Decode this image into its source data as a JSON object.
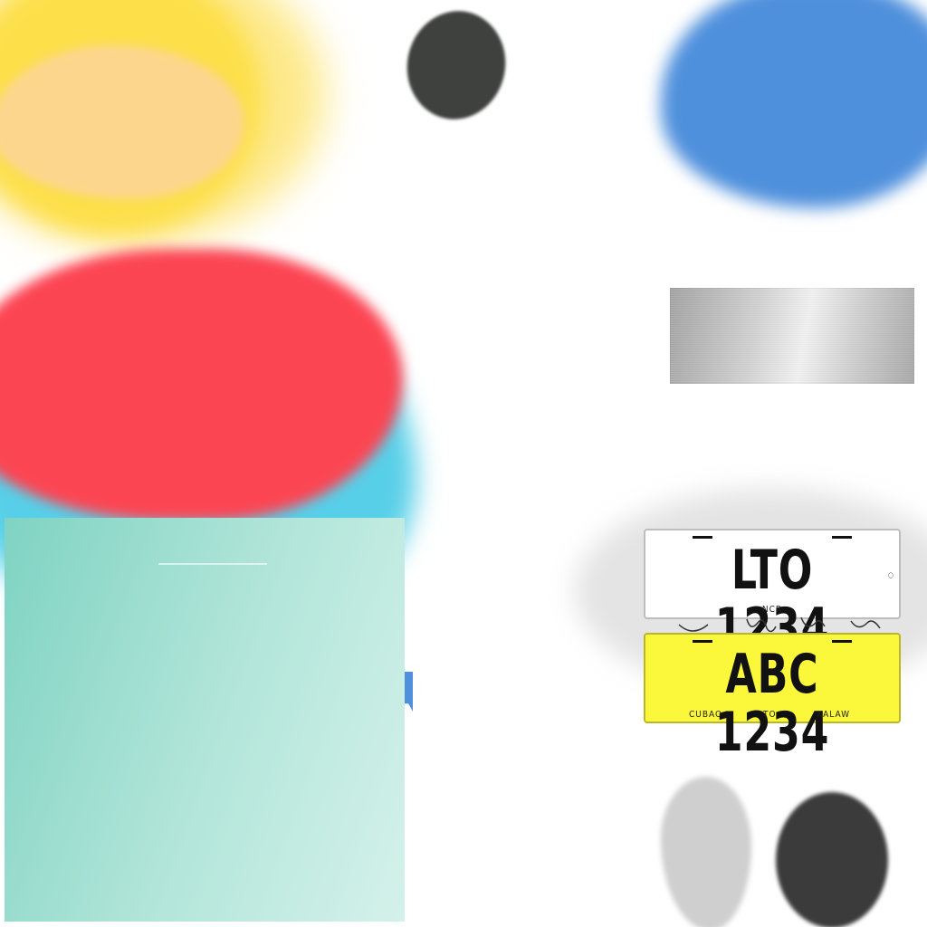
{
  "plates": {
    "white": {
      "number": "LTO 1234",
      "region": "NCR"
    },
    "yellow": {
      "number": "ABC 1234",
      "route_from": "CUBAO",
      "route_to_word": "TO",
      "route_to": "KALAW"
    }
  },
  "colors": {
    "yellow": "#fddf4a",
    "peach": "#fdd68e",
    "dark": "#3f413e",
    "blue": "#4f90dc",
    "red": "#fc4553",
    "cyan": "#58cfe8",
    "mint": "#b4e6da",
    "plate_yellow": "#fbf73a"
  }
}
